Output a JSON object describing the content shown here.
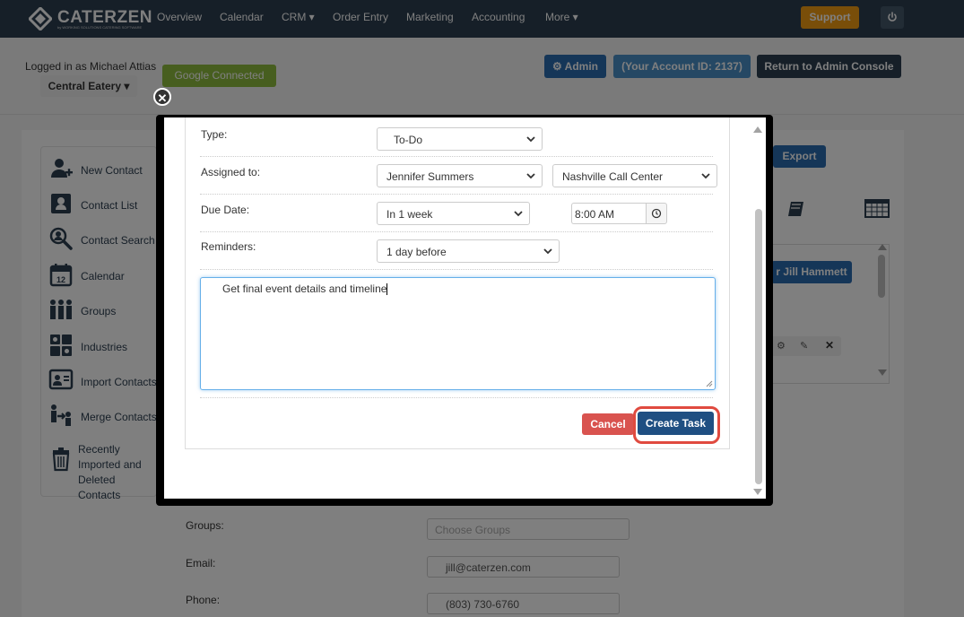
{
  "app": {
    "brand": "CATERZEN",
    "brand_sub": "by WORKING SOLUTIONS CATERING SOFTWARE"
  },
  "topnav": {
    "items": [
      "Overview",
      "Calendar",
      "CRM",
      "Order Entry",
      "Marketing",
      "Accounting",
      "More"
    ],
    "support_label": "Support",
    "power_icon": "power-icon"
  },
  "header": {
    "logged_in": "Logged in as Michael Attias",
    "location": "Central Eatery",
    "google": "Google Connected",
    "admin": "Admin",
    "account_id": "(Your Account ID: 2137)",
    "return": "Return to Admin Console"
  },
  "sidebar": {
    "items": [
      {
        "label": "New Contact",
        "icon": "add-user-icon"
      },
      {
        "label": "Contact List",
        "icon": "contact-book-icon"
      },
      {
        "label": "Contact Search",
        "icon": "search-user-icon"
      },
      {
        "label": "Calendar",
        "icon": "calendar-icon"
      },
      {
        "label": "Groups",
        "icon": "group-icon"
      },
      {
        "label": "Industries",
        "icon": "industries-icon"
      },
      {
        "label": "Import Contacts",
        "icon": "import-icon"
      },
      {
        "label": "Merge Contacts",
        "icon": "merge-icon"
      },
      {
        "label": "Recently Imported and Deleted Contacts",
        "icon": "trash-icon"
      }
    ]
  },
  "background": {
    "export": "Export",
    "assign_to": "r Jill Hammett",
    "groups_label": "Groups:",
    "groups_placeholder": "Choose Groups",
    "email_label": "Email:",
    "email_value": "jill@caterzen.com",
    "phone_label": "Phone:",
    "phone_value": "(803) 730-6760"
  },
  "modal": {
    "type_label": "Type:",
    "type_value": "To-Do",
    "assigned_label": "Assigned to:",
    "assigned_value": "Jennifer Summers",
    "location_value": "Nashville Call Center",
    "due_label": "Due Date:",
    "due_value": "In 1 week",
    "time_value": "8:00 AM",
    "reminders_label": "Reminders:",
    "reminders_value": "1 day before",
    "notes": "Get final event details and timeline",
    "cancel": "Cancel",
    "create": "Create Task"
  },
  "colors": {
    "nav": "#2c3e50",
    "support": "#f39c12",
    "google": "#8fbc3f",
    "cancel": "#d9534f",
    "create": "#1f4f82",
    "highlight": "#e04a3f"
  }
}
